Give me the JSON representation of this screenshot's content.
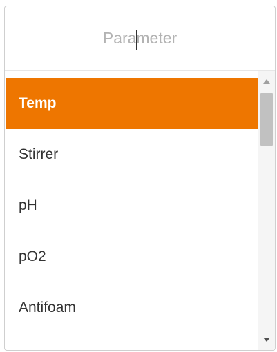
{
  "search": {
    "placeholder": "Parameter",
    "value": ""
  },
  "list": {
    "items": [
      {
        "label": "Temp",
        "selected": true
      },
      {
        "label": "Stirrer",
        "selected": false
      },
      {
        "label": "pH",
        "selected": false
      },
      {
        "label": "pO2",
        "selected": false
      },
      {
        "label": "Antifoam",
        "selected": false
      }
    ]
  },
  "colors": {
    "selected_background": "#ee7600",
    "selected_text": "#ffffff"
  }
}
